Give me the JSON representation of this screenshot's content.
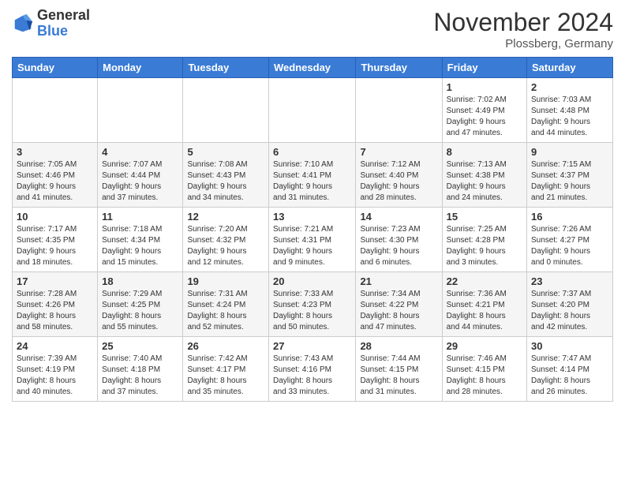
{
  "header": {
    "logo_general": "General",
    "logo_blue": "Blue",
    "month_title": "November 2024",
    "location": "Plossberg, Germany"
  },
  "weekdays": [
    "Sunday",
    "Monday",
    "Tuesday",
    "Wednesday",
    "Thursday",
    "Friday",
    "Saturday"
  ],
  "weeks": [
    [
      {
        "day": "",
        "info": ""
      },
      {
        "day": "",
        "info": ""
      },
      {
        "day": "",
        "info": ""
      },
      {
        "day": "",
        "info": ""
      },
      {
        "day": "",
        "info": ""
      },
      {
        "day": "1",
        "info": "Sunrise: 7:02 AM\nSunset: 4:49 PM\nDaylight: 9 hours\nand 47 minutes."
      },
      {
        "day": "2",
        "info": "Sunrise: 7:03 AM\nSunset: 4:48 PM\nDaylight: 9 hours\nand 44 minutes."
      }
    ],
    [
      {
        "day": "3",
        "info": "Sunrise: 7:05 AM\nSunset: 4:46 PM\nDaylight: 9 hours\nand 41 minutes."
      },
      {
        "day": "4",
        "info": "Sunrise: 7:07 AM\nSunset: 4:44 PM\nDaylight: 9 hours\nand 37 minutes."
      },
      {
        "day": "5",
        "info": "Sunrise: 7:08 AM\nSunset: 4:43 PM\nDaylight: 9 hours\nand 34 minutes."
      },
      {
        "day": "6",
        "info": "Sunrise: 7:10 AM\nSunset: 4:41 PM\nDaylight: 9 hours\nand 31 minutes."
      },
      {
        "day": "7",
        "info": "Sunrise: 7:12 AM\nSunset: 4:40 PM\nDaylight: 9 hours\nand 28 minutes."
      },
      {
        "day": "8",
        "info": "Sunrise: 7:13 AM\nSunset: 4:38 PM\nDaylight: 9 hours\nand 24 minutes."
      },
      {
        "day": "9",
        "info": "Sunrise: 7:15 AM\nSunset: 4:37 PM\nDaylight: 9 hours\nand 21 minutes."
      }
    ],
    [
      {
        "day": "10",
        "info": "Sunrise: 7:17 AM\nSunset: 4:35 PM\nDaylight: 9 hours\nand 18 minutes."
      },
      {
        "day": "11",
        "info": "Sunrise: 7:18 AM\nSunset: 4:34 PM\nDaylight: 9 hours\nand 15 minutes."
      },
      {
        "day": "12",
        "info": "Sunrise: 7:20 AM\nSunset: 4:32 PM\nDaylight: 9 hours\nand 12 minutes."
      },
      {
        "day": "13",
        "info": "Sunrise: 7:21 AM\nSunset: 4:31 PM\nDaylight: 9 hours\nand 9 minutes."
      },
      {
        "day": "14",
        "info": "Sunrise: 7:23 AM\nSunset: 4:30 PM\nDaylight: 9 hours\nand 6 minutes."
      },
      {
        "day": "15",
        "info": "Sunrise: 7:25 AM\nSunset: 4:28 PM\nDaylight: 9 hours\nand 3 minutes."
      },
      {
        "day": "16",
        "info": "Sunrise: 7:26 AM\nSunset: 4:27 PM\nDaylight: 9 hours\nand 0 minutes."
      }
    ],
    [
      {
        "day": "17",
        "info": "Sunrise: 7:28 AM\nSunset: 4:26 PM\nDaylight: 8 hours\nand 58 minutes."
      },
      {
        "day": "18",
        "info": "Sunrise: 7:29 AM\nSunset: 4:25 PM\nDaylight: 8 hours\nand 55 minutes."
      },
      {
        "day": "19",
        "info": "Sunrise: 7:31 AM\nSunset: 4:24 PM\nDaylight: 8 hours\nand 52 minutes."
      },
      {
        "day": "20",
        "info": "Sunrise: 7:33 AM\nSunset: 4:23 PM\nDaylight: 8 hours\nand 50 minutes."
      },
      {
        "day": "21",
        "info": "Sunrise: 7:34 AM\nSunset: 4:22 PM\nDaylight: 8 hours\nand 47 minutes."
      },
      {
        "day": "22",
        "info": "Sunrise: 7:36 AM\nSunset: 4:21 PM\nDaylight: 8 hours\nand 44 minutes."
      },
      {
        "day": "23",
        "info": "Sunrise: 7:37 AM\nSunset: 4:20 PM\nDaylight: 8 hours\nand 42 minutes."
      }
    ],
    [
      {
        "day": "24",
        "info": "Sunrise: 7:39 AM\nSunset: 4:19 PM\nDaylight: 8 hours\nand 40 minutes."
      },
      {
        "day": "25",
        "info": "Sunrise: 7:40 AM\nSunset: 4:18 PM\nDaylight: 8 hours\nand 37 minutes."
      },
      {
        "day": "26",
        "info": "Sunrise: 7:42 AM\nSunset: 4:17 PM\nDaylight: 8 hours\nand 35 minutes."
      },
      {
        "day": "27",
        "info": "Sunrise: 7:43 AM\nSunset: 4:16 PM\nDaylight: 8 hours\nand 33 minutes."
      },
      {
        "day": "28",
        "info": "Sunrise: 7:44 AM\nSunset: 4:15 PM\nDaylight: 8 hours\nand 31 minutes."
      },
      {
        "day": "29",
        "info": "Sunrise: 7:46 AM\nSunset: 4:15 PM\nDaylight: 8 hours\nand 28 minutes."
      },
      {
        "day": "30",
        "info": "Sunrise: 7:47 AM\nSunset: 4:14 PM\nDaylight: 8 hours\nand 26 minutes."
      }
    ]
  ]
}
